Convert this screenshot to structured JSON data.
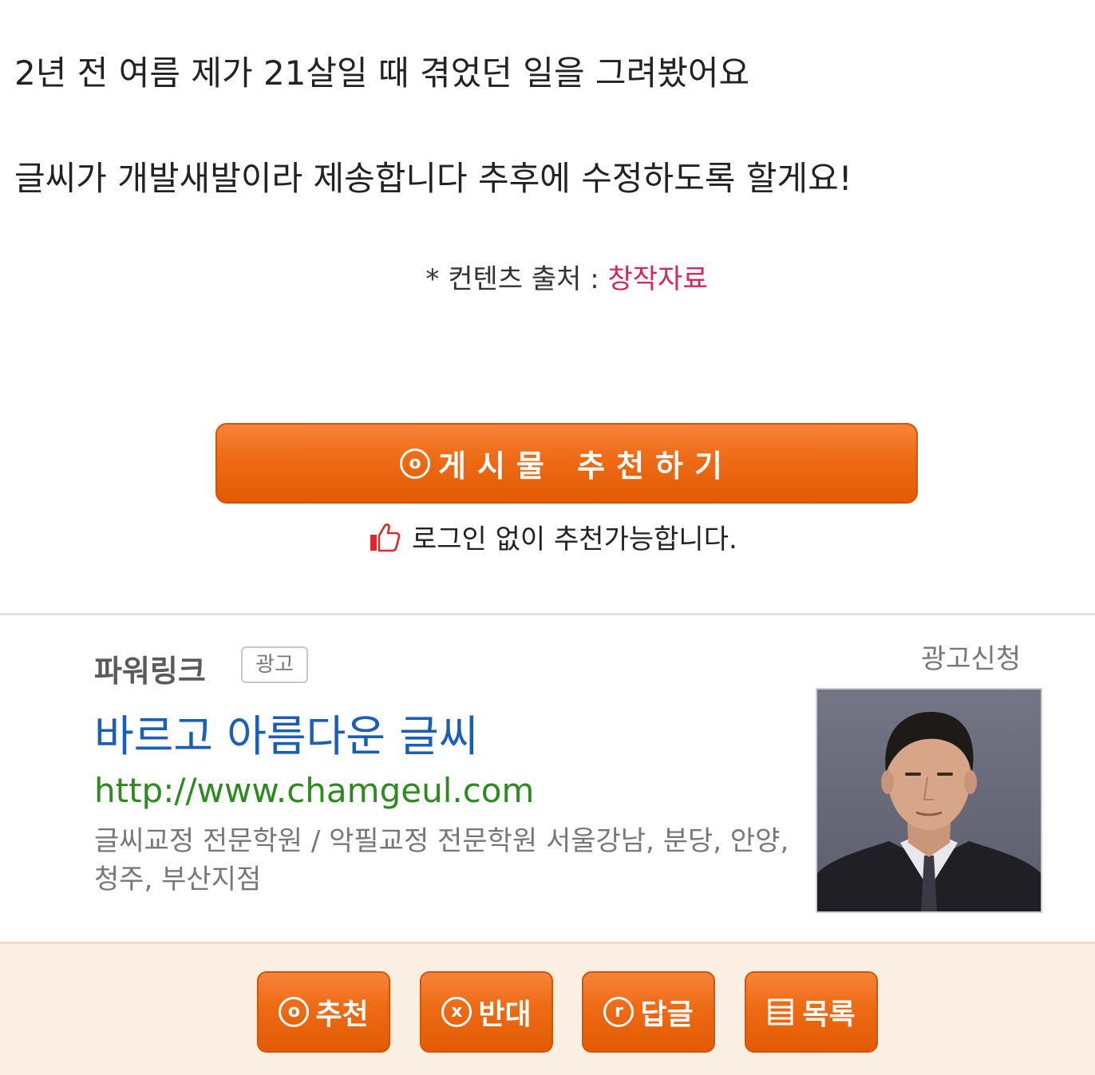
{
  "post": {
    "line1": "2년 전 여름 제가 21살일 때 겪었던 일을 그려봤어요",
    "line2": "글씨가 개발새발이라 제송합니다 추후에 수정하도록 할게요!",
    "source_label": "* 컨텐츠 출처 : ",
    "source_value": "창작자료"
  },
  "recommend": {
    "icon": "circle-o-icon",
    "icon_glyph": "o",
    "label": "게시물 추천하기",
    "note": "로그인 없이 추천가능합니다.",
    "note_icon": "thumbs-up-icon"
  },
  "ad": {
    "label": "파워링크",
    "badge": "광고",
    "request": "광고신청",
    "title": "바르고 아름다운 글씨",
    "url": "http://www.chamgeul.com",
    "description": "글씨교정 전문학원 / 악필교정 전문학원 서울강남, 분당, 안양, 청주, 부산지점",
    "photo": "portrait-photo"
  },
  "bottom_bar": {
    "buttons": [
      {
        "label": "추천",
        "icon": "circle-o-icon",
        "glyph": "o"
      },
      {
        "label": "반대",
        "icon": "circle-x-icon",
        "glyph": "x"
      },
      {
        "label": "답글",
        "icon": "circle-r-icon",
        "glyph": "r"
      },
      {
        "label": "목록",
        "icon": "list-icon"
      }
    ]
  },
  "colors": {
    "button_orange": "#ee6a14",
    "source_pink": "#d6245c",
    "ad_title_blue": "#1a5eb8",
    "ad_url_green": "#2d8a1e",
    "bottom_bar_bg": "#fbefe4"
  }
}
